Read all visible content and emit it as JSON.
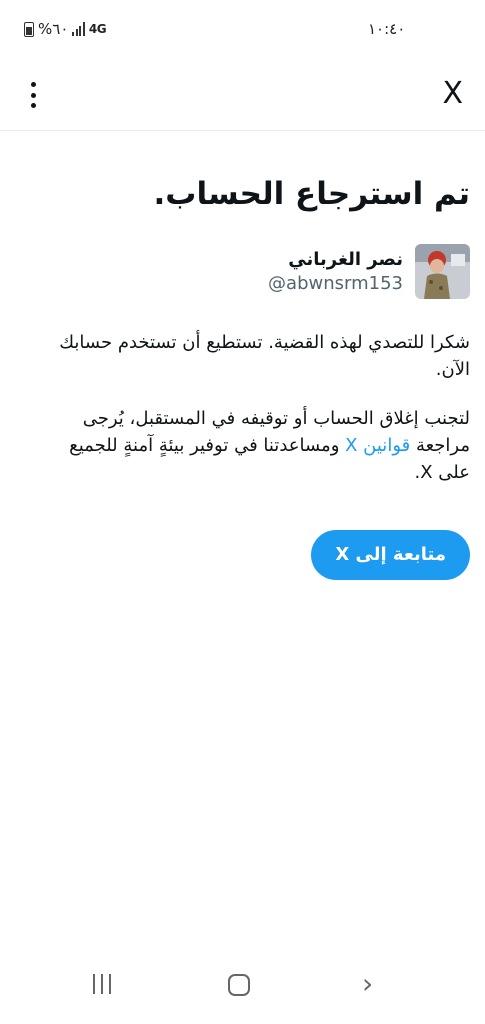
{
  "status_bar": {
    "time": "١٠:٤٠",
    "battery": "%٦٠",
    "network": "4G"
  },
  "top_bar": {
    "close_label": "X"
  },
  "content": {
    "title": "تم استرجاع الحساب.",
    "user": {
      "name": "نصر الغرباني",
      "handle": "@abwnsrm153"
    },
    "paragraph1": "شكرا للتصدي لهذه القضية. تستطيع أن تستخدم حسابك الآن.",
    "paragraph2_before": "لتجنب إغلاق الحساب أو توقيفه في المستقبل، يُرجى مراجعة ",
    "paragraph2_link": "قوانين X",
    "paragraph2_after": " ومساعدتنا في توفير بيئةٍ آمنةٍ للجميع على X.",
    "continue_button": "متابعة إلى X"
  },
  "colors": {
    "accent": "#1d9bf0",
    "text": "#0f1419",
    "muted": "#536471"
  }
}
